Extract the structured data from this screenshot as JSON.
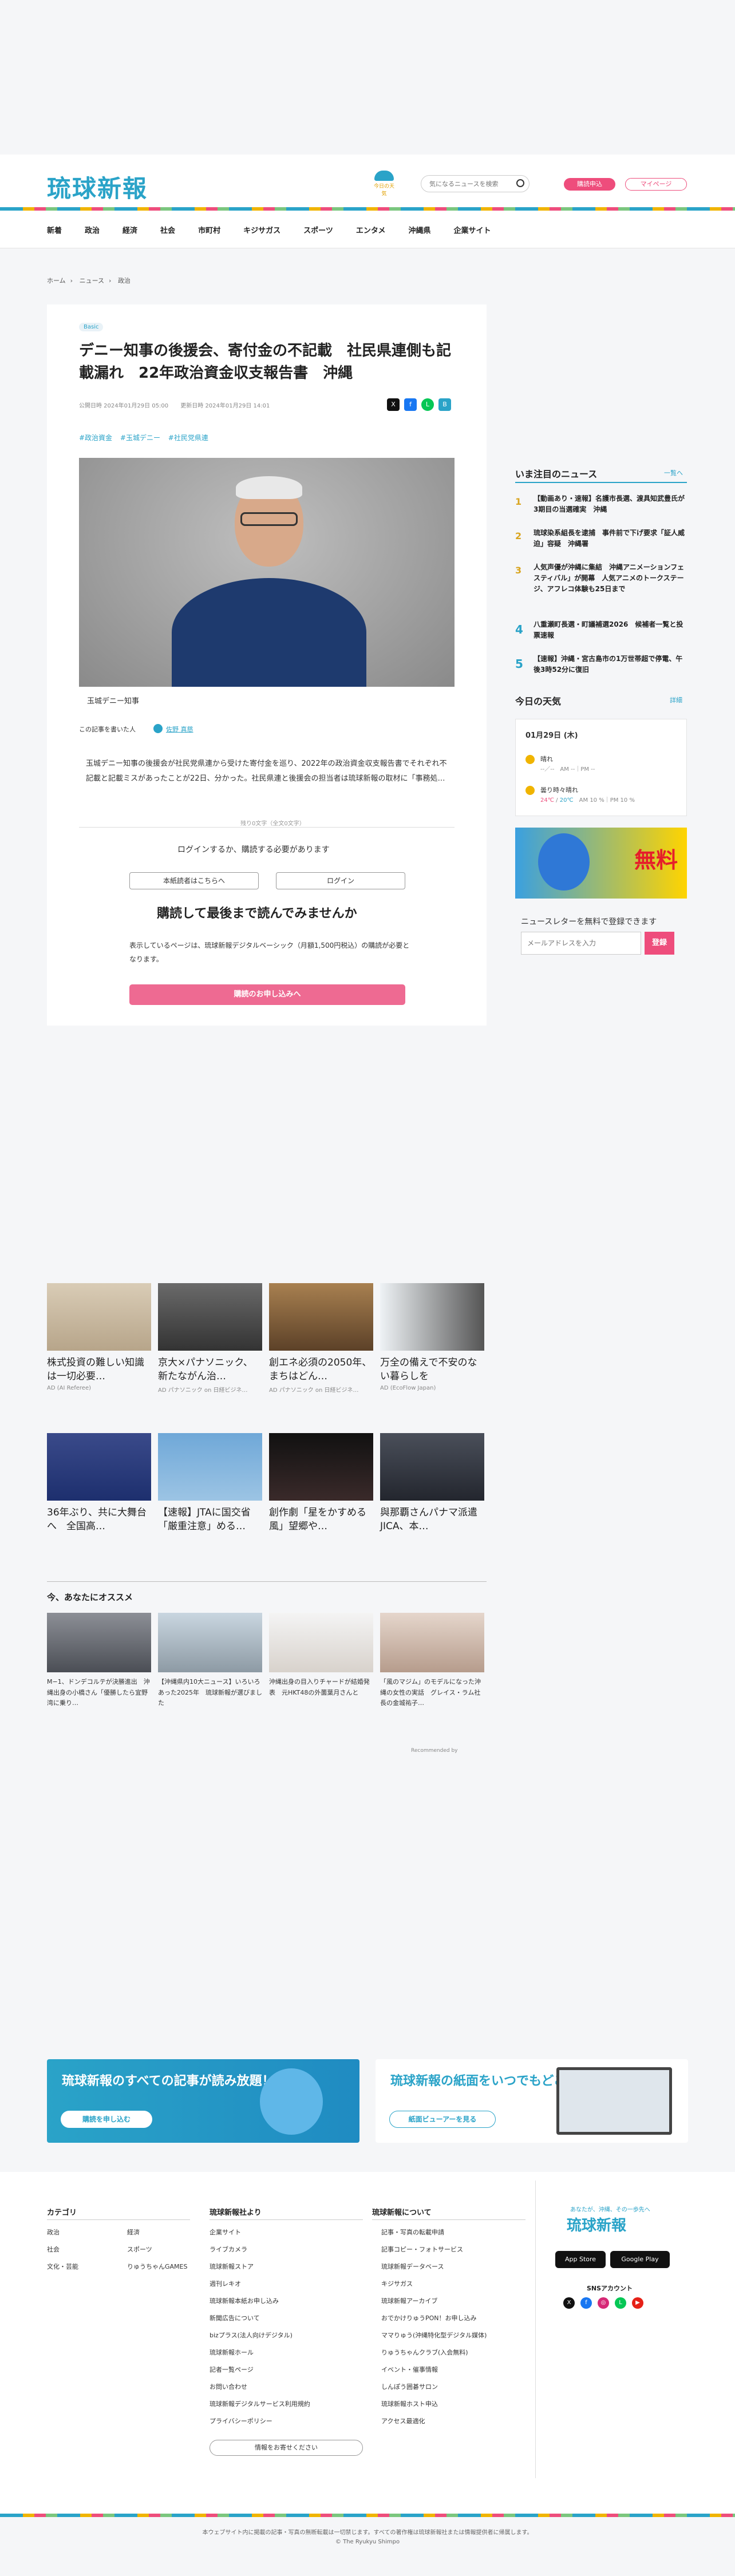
{
  "header": {
    "logo": "琉球新報",
    "weather_label": "今日の天気",
    "search_placeholder": "気になるニュースを検索",
    "subscribe_btn": "購読申込",
    "mypage_btn": "マイページ"
  },
  "nav": [
    "新着",
    "政治",
    "経済",
    "社会",
    "市町村",
    "キジサガス",
    "スポーツ",
    "エンタメ",
    "沖縄県",
    "企業サイト"
  ],
  "breadcrumb": [
    "ホーム",
    "ニュース",
    "政治"
  ],
  "article": {
    "tag": "Basic",
    "title": "デニー知事の後援会、寄付金の不記載　社民県連側も記載漏れ　22年政治資金収支報告書　沖縄",
    "published": "公開日時 2024年01月29日 05:00",
    "updated": "更新日時 2024年01月29日 14:01",
    "hashtags": [
      "#政治資金",
      "#玉城デニー",
      "#社民党県連"
    ],
    "caption": "玉城デニー知事",
    "author_label": "この記事を書いた人",
    "author_name": "佐野 真慈",
    "body": "玉城デニー知事の後援会が社民党県連から受けた寄付金を巡り、2022年の政治資金収支報告書でそれぞれ不記載と記載ミスがあったことが22日、分かった。社民県連と後援会の担当者は琉球新報の取材に「事務処…",
    "remaining": "残り0文字（全文0文字）",
    "login_msg": "ログインするか、購読する必要があります",
    "reader_btn": "本紙読者はこちらへ",
    "login_btn": "ログイン",
    "promo_title": "購読して最後まで読んでみませんか",
    "promo_desc": "表示しているページは、琉球新報デジタルベーシック（月額1,500円税込）の購読が必要となります。",
    "subscribe_btn": "購読のお申し込みへ"
  },
  "sidebar": {
    "ranking_title": "いま注目のニュース",
    "more": "一覧へ",
    "ranking": [
      {
        "num": "1",
        "text": "【動画あり・速報】名護市長選、渡具知武豊氏が3期目の当選確実　沖縄"
      },
      {
        "num": "2",
        "text": "琉球染系組長を逮捕　事件前で下げ要求「証人威迫」容疑　沖縄署"
      },
      {
        "num": "3",
        "text": "人気声優が沖縄に集結　沖縄アニメーションフェスティバル」が開幕　人気アニメのトークステージ、アフレコ体験も25日まで"
      },
      {
        "num": "4",
        "text": "八重瀬町長選・町議補選2026　候補者一覧と投票速報"
      },
      {
        "num": "5",
        "text": "【速報】沖縄・宮古島市の1万世帯超で停電、午後3時52分に復旧"
      }
    ],
    "weather_title": "今日の天気",
    "weather_detail": "詳細",
    "weather_date": "01月29日 (木)",
    "w_am_label": "晴れ",
    "w_am_sub": "--／--　AM --｜PM --",
    "w_pm_label": "曇り時々晴れ",
    "w_pm_hi": "24℃",
    "w_pm_lo": "20℃",
    "w_pm_sub": "AM 10 %｜PM 10 %",
    "banner_text": "無料",
    "newsletter_title": "ニュースレターを無料で登録できます",
    "newsletter_placeholder": "メールアドレスを入力",
    "newsletter_btn": "登録"
  },
  "ads_row1": [
    {
      "cap": "株式投資の難しい知識は一切必要…",
      "src": "AD (AI Referee)"
    },
    {
      "cap": "京大×パナソニック、新たながん治…",
      "src": "AD パナソニック on 日経ビジネ…"
    },
    {
      "cap": "創エネ必須の2050年、まちはどん…",
      "src": "AD パナソニック on 日経ビジネ…"
    },
    {
      "cap": "万全の備えで不安のない暮らしを",
      "src": "AD (EcoFlow Japan)"
    }
  ],
  "ads_row2": [
    {
      "cap": "36年ぶり、共に大舞台へ　全国高…"
    },
    {
      "cap": "【速報】JTAに国交省「厳重注意」める…"
    },
    {
      "cap": "創作劇「星をかすめる風」望郷や…"
    },
    {
      "cap": "與那覇さんパナマ派遣　JICA、本…"
    }
  ],
  "recommend": {
    "title": "今、あなたにオススメ",
    "items": [
      {
        "cap": "M−1、ドンデコルテが決勝進出　沖縄出身の小橋さん「優勝したら宜野湾に乗り…"
      },
      {
        "cap": "【沖縄県内10大ニュース】いろいろあった2025年　琉球新報が選びました"
      },
      {
        "cap": "沖縄出身の目入りチャードが結婚発表　元HKT48の外薗葉月さんと"
      },
      {
        "cap": "「風のマジム」のモデルになった沖縄の女性の実話　グレイス・ラム社長の金城祐子…"
      }
    ],
    "powered": "Recommended by"
  },
  "promo": {
    "left_title": "琉球新報のすべての記事が読み放題！",
    "left_btn": "購読を申し込む",
    "right_title": "琉球新報の紙面をいつでもどこでも。",
    "right_btn": "紙面ビューアーを見る"
  },
  "footer": {
    "col1_title": "カテゴリ",
    "col1a": [
      "政治",
      "社会",
      "文化・芸能"
    ],
    "col1b": [
      "経済",
      "スポーツ",
      "りゅうちゃんGAMES"
    ],
    "col2_title": "琉球新報社より",
    "col2": [
      "企業サイト",
      "ライブカメラ",
      "琉球新報ストア",
      "週刊レキオ",
      "琉球新報本紙お申し込み",
      "新聞広告について",
      "bizプラス(法人向けデジタル)",
      "琉球新報ホール",
      "記者一覧ページ",
      "お問い合わせ",
      "琉球新報デジタルサービス利用規約",
      "プライバシーポリシー"
    ],
    "col2_btn": "情報をお寄せください",
    "col3_title": "琉球新報について",
    "col3": [
      "記事・写真の転載申請",
      "記事コピー・フォトサービス",
      "琉球新報データベース",
      "キジサガス",
      "琉球新報アーカイブ",
      "おでかけりゅうPON！お申し込み",
      "ママりゅう(沖縄特化型デジタル媒体)",
      "りゅうちゃんクラブ(入会無料)",
      "イベント・催事情報",
      "しんぽう囲碁サロン",
      "琉球新報ホスト申込",
      "アクセス最適化"
    ],
    "logo_sub": "あなたが、沖縄、その一歩先へ",
    "logo": "琉球新報",
    "app_store": "App Store",
    "google_play": "Google Play",
    "sns_title": "SNSアカウント",
    "copyright1": "本ウェブサイト内に掲載の記事・写真の無断転載は一切禁じます。すべての著作権は琉球新報社または情報提供者に帰属します。",
    "copyright2": "© The Ryukyu Shimpo"
  }
}
